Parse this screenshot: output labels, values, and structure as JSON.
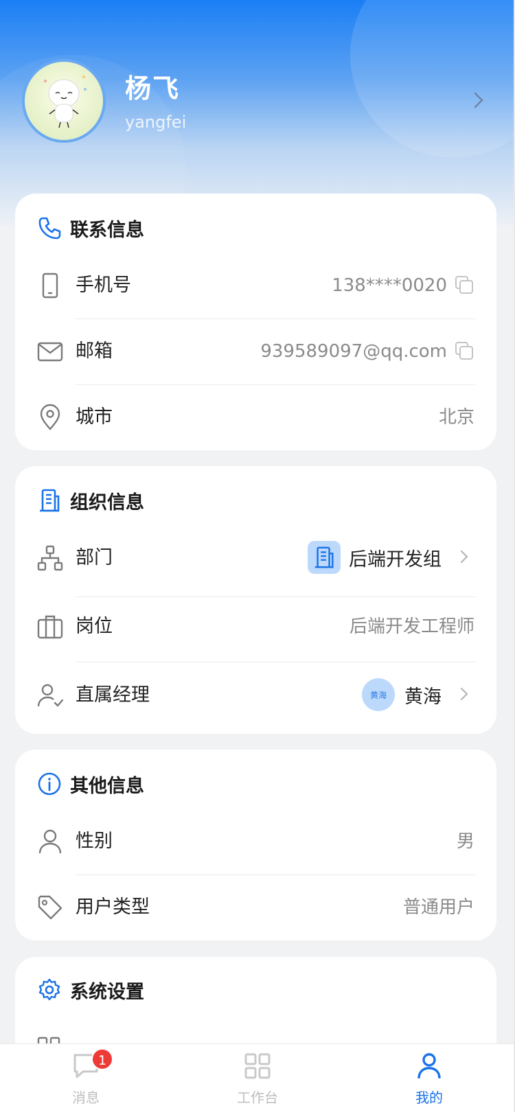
{
  "profile": {
    "name": "杨飞",
    "account": "yangfei"
  },
  "contact": {
    "title": "联系信息",
    "phone_label": "手机号",
    "phone_value": "138****0020",
    "email_label": "邮箱",
    "email_value": "939589097@qq.com",
    "city_label": "城市",
    "city_value": "北京"
  },
  "org": {
    "title": "组织信息",
    "dept_label": "部门",
    "dept_value": "后端开发组",
    "position_label": "岗位",
    "position_value": "后端开发工程师",
    "manager_label": "直属经理",
    "manager_avatar_text": "黄海",
    "manager_value": "黄海"
  },
  "other": {
    "title": "其他信息",
    "gender_label": "性别",
    "gender_value": "男",
    "usertype_label": "用户类型",
    "usertype_value": "普通用户"
  },
  "settings": {
    "title": "系统设置"
  },
  "tabbar": {
    "messages_label": "消息",
    "messages_badge": "1",
    "workbench_label": "工作台",
    "mine_label": "我的",
    "active_color": "#1a72e8",
    "inactive_color": "#bdbdbd"
  },
  "theme": {
    "primary": "#1a7ff5",
    "badge": "#ee3a36"
  }
}
